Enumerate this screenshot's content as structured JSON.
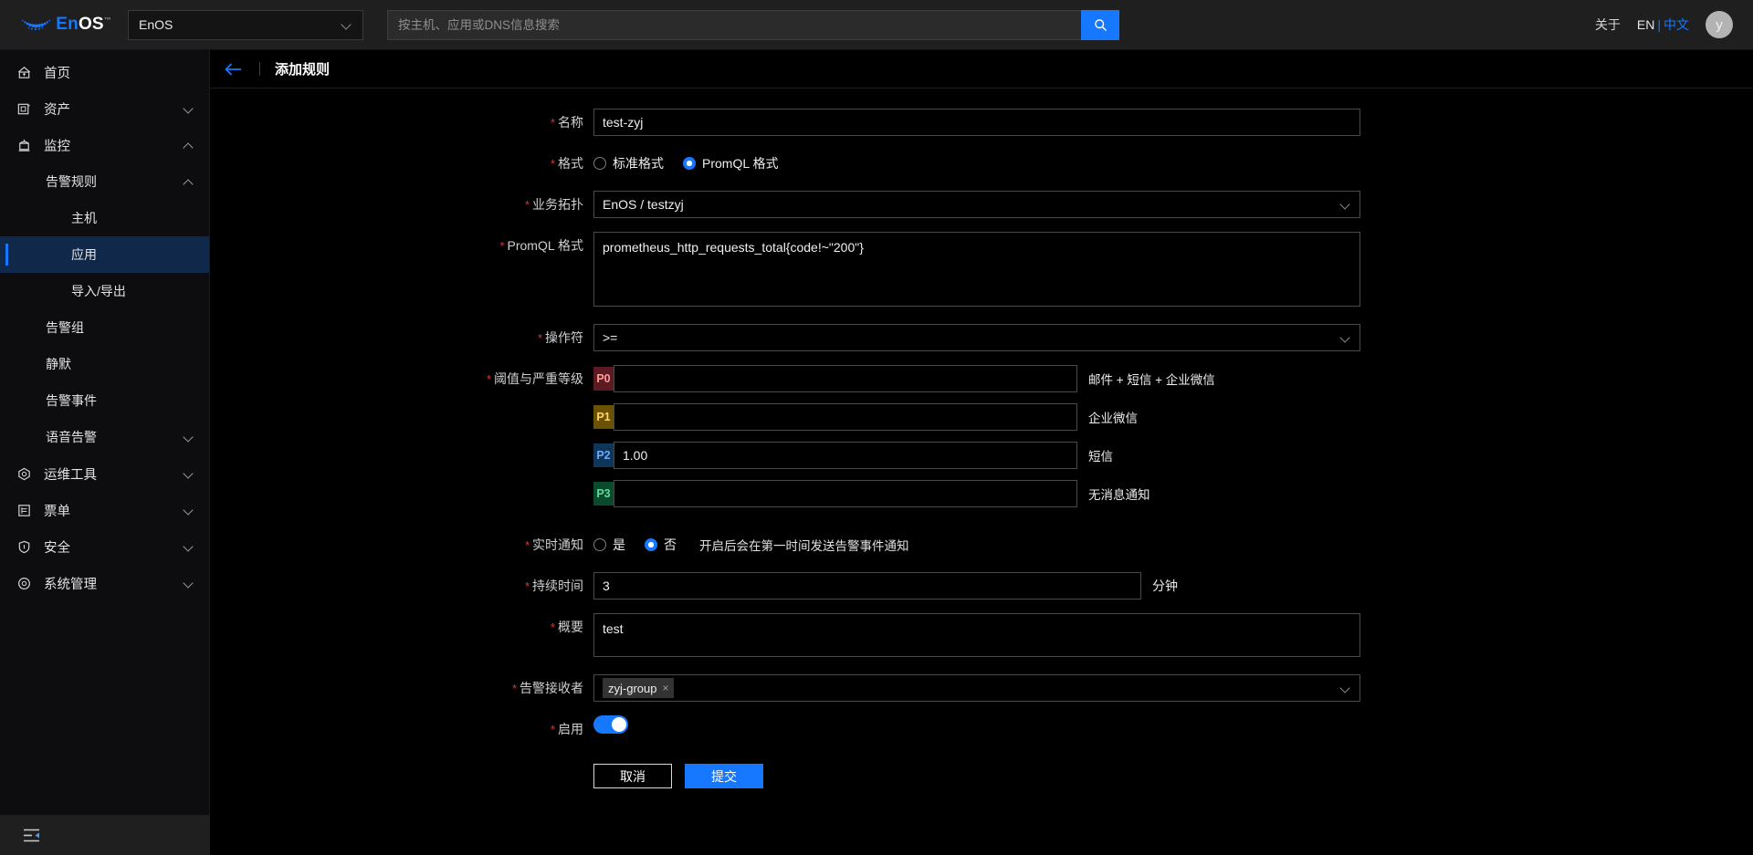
{
  "topbar": {
    "logo_text_en": "En",
    "logo_text_os": "OS",
    "logo_tm": "™",
    "env_value": "EnOS",
    "search_placeholder": "按主机、应用或DNS信息搜索",
    "about": "关于",
    "lang_en": "EN",
    "lang_sep": "|",
    "lang_cn": "中文",
    "avatar_initial": "y"
  },
  "sidebar": {
    "items": [
      {
        "label": "首页",
        "icon": "home-icon",
        "level": 1,
        "arrow": "none",
        "active": false
      },
      {
        "label": "资产",
        "icon": "assets-icon",
        "level": 1,
        "arrow": "down",
        "active": false
      },
      {
        "label": "监控",
        "icon": "monitor-icon",
        "level": 1,
        "arrow": "up",
        "active": false
      },
      {
        "label": "告警规则",
        "icon": "none",
        "level": 2,
        "arrow": "up",
        "active": false
      },
      {
        "label": "主机",
        "icon": "none",
        "level": 3,
        "arrow": "none",
        "active": false
      },
      {
        "label": "应用",
        "icon": "none",
        "level": 3,
        "arrow": "none",
        "active": true
      },
      {
        "label": "导入/导出",
        "icon": "none",
        "level": 3,
        "arrow": "none",
        "active": false
      },
      {
        "label": "告警组",
        "icon": "none",
        "level": 2,
        "arrow": "none",
        "active": false
      },
      {
        "label": "静默",
        "icon": "none",
        "level": 2,
        "arrow": "none",
        "active": false
      },
      {
        "label": "告警事件",
        "icon": "none",
        "level": 2,
        "arrow": "none",
        "active": false
      },
      {
        "label": "语音告警",
        "icon": "none",
        "level": 2,
        "arrow": "down",
        "active": false
      },
      {
        "label": "运维工具",
        "icon": "tools-icon",
        "level": 1,
        "arrow": "down",
        "active": false
      },
      {
        "label": "票单",
        "icon": "ticket-icon",
        "level": 1,
        "arrow": "down",
        "active": false
      },
      {
        "label": "安全",
        "icon": "shield-icon",
        "level": 1,
        "arrow": "down",
        "active": false
      },
      {
        "label": "系统管理",
        "icon": "settings-icon",
        "level": 1,
        "arrow": "down",
        "active": false
      }
    ],
    "collapse_icon": "menu-fold-icon"
  },
  "page": {
    "title": "添加规则",
    "back_icon": "arrow-left-icon"
  },
  "form": {
    "name": {
      "label": "名称",
      "value": "test-zyj",
      "required": true
    },
    "format": {
      "label": "格式",
      "required": true,
      "options": [
        {
          "label": "标准格式",
          "selected": false
        },
        {
          "label": "PromQL 格式",
          "selected": true
        }
      ]
    },
    "topology": {
      "label": "业务拓扑",
      "value": "EnOS / testzyj",
      "required": true
    },
    "promql": {
      "label": "PromQL 格式",
      "value": "prometheus_http_requests_total{code!~\"200\"}",
      "required": true
    },
    "operator": {
      "label": "操作符",
      "value": ">=",
      "required": true
    },
    "severity": {
      "label": "阈值与严重等级",
      "required": true,
      "levels": [
        {
          "code": "P0",
          "value": "",
          "note": "邮件 + 短信 + 企业微信",
          "bg": "#5c1a22",
          "fg": "#ff9c9c"
        },
        {
          "code": "P1",
          "value": "",
          "note": "企业微信",
          "bg": "#6b5102",
          "fg": "#ffd666"
        },
        {
          "code": "P2",
          "value": "1.00",
          "note": "短信",
          "bg": "#0f3557",
          "fg": "#69a9ff"
        },
        {
          "code": "P3",
          "value": "",
          "note": "无消息通知",
          "bg": "#0c4a2e",
          "fg": "#5ddb9a"
        }
      ]
    },
    "realtime": {
      "label": "实时通知",
      "required": true,
      "options": [
        {
          "label": "是",
          "selected": false
        },
        {
          "label": "否",
          "selected": true
        }
      ],
      "hint": "开启后会在第一时间发送告警事件通知"
    },
    "duration": {
      "label": "持续时间",
      "value": "3",
      "unit": "分钟",
      "required": true
    },
    "summary": {
      "label": "概要",
      "value": "test",
      "required": true
    },
    "receivers": {
      "label": "告警接收者",
      "required": true,
      "tags": [
        "zyj-group"
      ],
      "tag_remove": "×"
    },
    "enabled": {
      "label": "启用",
      "required": true,
      "on": true
    },
    "buttons": {
      "cancel": "取消",
      "submit": "提交"
    }
  }
}
